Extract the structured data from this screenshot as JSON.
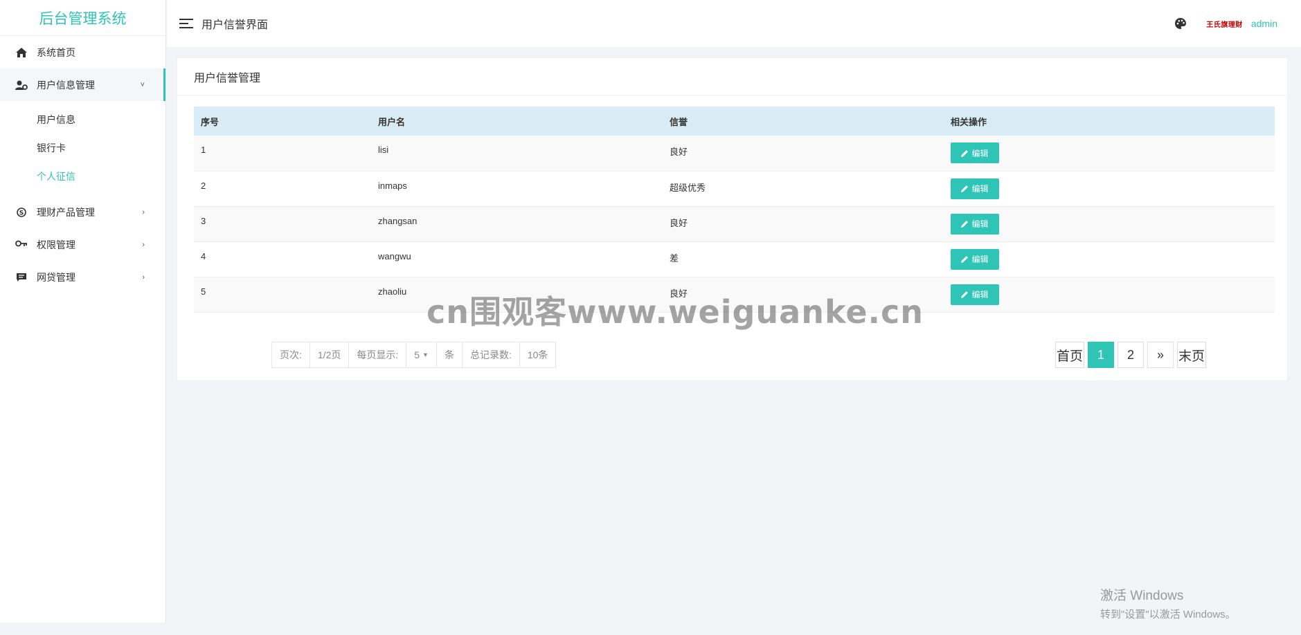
{
  "sidebar": {
    "logo": "后台管理系统",
    "items": [
      {
        "label": "系统首页",
        "icon": "home-icon"
      },
      {
        "label": "用户信息管理",
        "icon": "user-gear-icon",
        "expanded": true,
        "children": [
          {
            "label": "用户信息"
          },
          {
            "label": "银行卡"
          },
          {
            "label": "个人征信",
            "current": true
          }
        ]
      },
      {
        "label": "理财产品管理",
        "icon": "skype-icon"
      },
      {
        "label": "权限管理",
        "icon": "key-icon"
      },
      {
        "label": "网贷管理",
        "icon": "comment-icon"
      }
    ]
  },
  "header": {
    "title": "用户信誉界面",
    "user_badge": "王氏旗理财",
    "username": "admin"
  },
  "panel": {
    "title": "用户信誉管理",
    "columns": [
      "序号",
      "用户名",
      "信誉",
      "相关操作"
    ],
    "edit_label": "编辑",
    "rows": [
      {
        "id": "1",
        "username": "lisi",
        "credit": "良好"
      },
      {
        "id": "2",
        "username": "inmaps",
        "credit": "超级优秀"
      },
      {
        "id": "3",
        "username": "zhangsan",
        "credit": "良好"
      },
      {
        "id": "4",
        "username": "wangwu",
        "credit": "差"
      },
      {
        "id": "5",
        "username": "zhaoliu",
        "credit": "良好"
      }
    ]
  },
  "page_info": {
    "page_label": "页次:",
    "page_value": "1/2页",
    "per_page_label": "每页显示:",
    "per_page_value": "5",
    "unit": "条",
    "total_label": "总记录数:",
    "total_value": "10条"
  },
  "pager": {
    "first": "首页",
    "pages": [
      "1",
      "2"
    ],
    "current": "1",
    "next": "»",
    "last": "末页"
  },
  "watermark": "cn围观客www.weiguanke.cn",
  "windows_activation": {
    "line1": "激活 Windows",
    "line2": "转到\"设置\"以激活 Windows。"
  },
  "colors": {
    "accent": "#2ec4b6",
    "table_header": "#d9ecf5",
    "background": "#f3f4f8"
  }
}
